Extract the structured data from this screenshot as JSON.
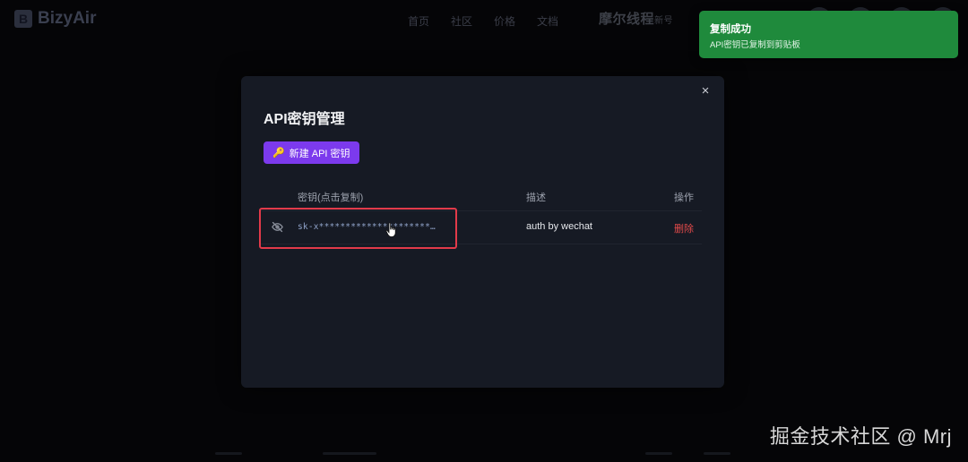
{
  "app": {
    "logo_letter": "B",
    "name": "BizyAir",
    "nav": [
      "首页",
      "社区",
      "价格",
      "文档"
    ],
    "top_watermark": "摩尔线程",
    "top_watermark_suffix": "新号"
  },
  "modal": {
    "title": "API密钥管理",
    "close_glyph": "×",
    "new_key_icon": "🔑",
    "new_key_label": "新建 API 密钥",
    "columns": {
      "key": "密钥(点击复制)",
      "description": "描述",
      "actions": "操作"
    },
    "rows": [
      {
        "key": "sk-x*********************…",
        "description": "auth by wechat",
        "delete_label": "删除"
      }
    ]
  },
  "toast": {
    "title": "复制成功",
    "message": "API密钥已复制到剪贴板",
    "color": "#1f8a3c"
  },
  "watermark": "掘金技术社区 @ Mrj",
  "colors": {
    "accent": "#7c3aed",
    "danger": "#e24a4a",
    "highlight": "#e23a4a"
  }
}
